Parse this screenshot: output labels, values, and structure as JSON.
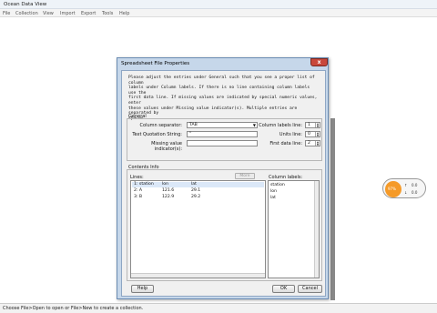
{
  "app": {
    "title": "Ocean Data View",
    "menu": [
      "File",
      "Collection",
      "View",
      "Import",
      "Export",
      "Tools",
      "Help"
    ],
    "status": "Choose File>Open to open or File>New to create a collection."
  },
  "map_widget": {
    "disc_text": "97%",
    "values": [
      "0.0",
      "0.0"
    ]
  },
  "dialog": {
    "title": "Spreadsheet File Properties",
    "close_label": "x",
    "instructions": [
      "Please adjust the entries under General such that you see a proper list of column",
      "labels under Column labels. If there is no line containing column labels use the",
      "first data line. If missing values are indicated by special numeric values, enter",
      "these values under Missing value indicator(s). Multiple entries are separated by",
      "spaces."
    ],
    "general": {
      "label": "General",
      "column_separator_label": "Column separator:",
      "column_separator_value": "TAB",
      "text_quotation_label": "Text Quotation String:",
      "text_quotation_value": "\"",
      "missing_value_label": "Missing value indicator(s):",
      "missing_value_value": "",
      "column_labels_line_label": "Column labels line:",
      "column_labels_line_value": "1",
      "units_line_label": "Units line:",
      "units_line_value": "0",
      "first_data_line_label": "First data line:",
      "first_data_line_value": "2"
    },
    "contents": {
      "label": "Contents Info",
      "lines_label": "Lines:",
      "more_label": "More",
      "lines": [
        [
          "1: station",
          "lon",
          "lat"
        ],
        [
          "2: A",
          "121.6",
          "29.1"
        ],
        [
          "3: B",
          "122.9",
          "29.2"
        ]
      ],
      "column_labels_label": "Column labels:",
      "column_labels": [
        "station",
        "lon",
        "lat"
      ]
    },
    "help_label": "Help",
    "ok_label": "OK",
    "cancel_label": "Cancel"
  }
}
